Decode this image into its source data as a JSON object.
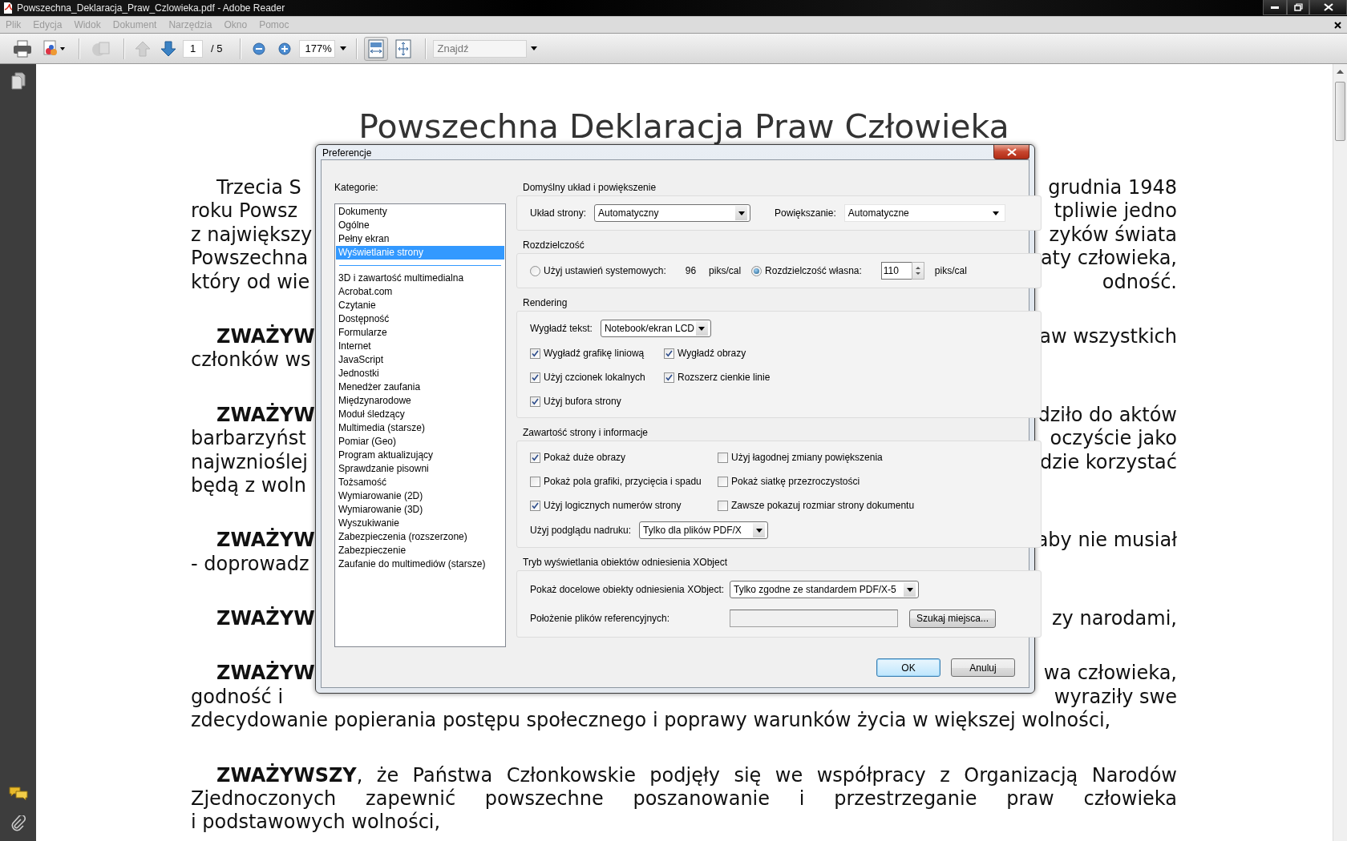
{
  "window": {
    "title": "Powszechna_Deklaracja_Praw_Czlowieka.pdf - Adobe Reader"
  },
  "menu": [
    {
      "label": "Plik",
      "disabled": true
    },
    {
      "label": "Edycja",
      "disabled": true
    },
    {
      "label": "Widok",
      "disabled": true
    },
    {
      "label": "Dokument",
      "disabled": true
    },
    {
      "label": "Narzędzia",
      "disabled": true
    },
    {
      "label": "Okno",
      "disabled": true
    },
    {
      "label": "Pomoc",
      "disabled": true
    }
  ],
  "toolbar": {
    "page_field": "1",
    "page_total": "/ 5",
    "zoom_field": "177%",
    "fit_width": {
      "pressed": true
    },
    "search": {
      "placeholder": "Znajdź"
    }
  },
  "document": {
    "title": "Powszechna Deklaracja Praw Człowieka",
    "paragraphs": [
      {
        "lines": [
          {
            "kind": "split",
            "left": "Trzecia S",
            "right": "grudnia 1948"
          },
          {
            "kind": "split",
            "left": "roku Powsz",
            "right": "tpliwie jedno"
          },
          {
            "kind": "split",
            "left": "z największy",
            "right": "zyków świata"
          },
          {
            "kind": "split",
            "left": "Powszechna",
            "right": "aty człowieka,"
          },
          {
            "kind": "split",
            "left": "który od wie",
            "right": "odność."
          }
        ]
      },
      {
        "lines": [
          {
            "kind": "split",
            "left": "**ZWAŻYW**",
            "right": "aw wszystkich"
          },
          {
            "kind": "split",
            "left": "członków ws"
          }
        ]
      },
      {
        "lines": [
          {
            "kind": "split",
            "left": "**ZWAŻYW**",
            "right": "dziło do aktów"
          },
          {
            "kind": "split",
            "left": "barbarzyńst",
            "right": "oczyście jako"
          },
          {
            "kind": "split",
            "left": "najwznioślej",
            "right": "dzie korzystać"
          },
          {
            "kind": "split",
            "left": "będą z woln"
          }
        ]
      },
      {
        "lines": [
          {
            "kind": "split",
            "left": "**ZWAŻYW**",
            "right": "aby nie musiał"
          },
          {
            "kind": "split",
            "left": "- doprowadz"
          }
        ]
      },
      {
        "lines": [
          {
            "kind": "split",
            "left": "**ZWAŻYW**",
            "right": "zy narodami,"
          }
        ]
      },
      {
        "lines": [
          {
            "kind": "split",
            "left": "**ZWAŻYW**",
            "right": "wa człowieka,"
          },
          {
            "kind": "split",
            "left": "godność i",
            "right": "wyraziły swe"
          },
          {
            "kind": "plain",
            "text": "zdecydowanie popierania postępu społecznego i poprawy warunków życia w większej wolności,"
          }
        ]
      },
      {
        "lines": [
          {
            "kind": "justified",
            "text": "**ZWAŻYWSZY**, że Państwa Członkowskie podjęły się we współpracy z Organizacją Narodów"
          },
          {
            "kind": "justified",
            "text": "Zjednoczonych zapewnić powszechne poszanowanie i przestrzeganie praw człowieka"
          },
          {
            "kind": "plain",
            "text": "i podstawowych wolności,"
          }
        ]
      }
    ]
  },
  "dialog": {
    "title": "Preferencje",
    "categories_label": "Kategorie:",
    "category_groups": [
      {
        "items": [
          {
            "label": "Dokumenty",
            "selected": false
          },
          {
            "label": "Ogólne",
            "selected": false
          },
          {
            "label": "Pełny ekran",
            "selected": false
          },
          {
            "label": "Wyświetlanie strony",
            "selected": true
          }
        ]
      },
      {
        "items": [
          {
            "label": "3D i zawartość multimedialna",
            "selected": false
          },
          {
            "label": "Acrobat.com",
            "selected": false
          },
          {
            "label": "Czytanie",
            "selected": false
          },
          {
            "label": "Dostępność",
            "selected": false
          },
          {
            "label": "Formularze",
            "selected": false
          },
          {
            "label": "Internet",
            "selected": false
          },
          {
            "label": "JavaScript",
            "selected": false
          },
          {
            "label": "Jednostki",
            "selected": false
          },
          {
            "label": "Menedżer zaufania",
            "selected": false
          },
          {
            "label": "Międzynarodowe",
            "selected": false
          },
          {
            "label": "Moduł śledzący",
            "selected": false
          },
          {
            "label": "Multimedia (starsze)",
            "selected": false
          },
          {
            "label": "Pomiar (Geo)",
            "selected": false
          },
          {
            "label": "Program aktualizujący",
            "selected": false
          },
          {
            "label": "Sprawdzanie pisowni",
            "selected": false
          },
          {
            "label": "Tożsamość",
            "selected": false
          },
          {
            "label": "Wymiarowanie (2D)",
            "selected": false
          },
          {
            "label": "Wymiarowanie (3D)",
            "selected": false
          },
          {
            "label": "Wyszukiwanie",
            "selected": false
          },
          {
            "label": "Zabezpieczenia (rozszerzone)",
            "selected": false
          },
          {
            "label": "Zabezpieczenie",
            "selected": false
          },
          {
            "label": "Zaufanie do multimediów (starsze)",
            "selected": false
          }
        ]
      }
    ],
    "sections": [
      {
        "kind": "layout",
        "title": "Domyślny układ i powiększenie",
        "rows": [
          {
            "kind": "line",
            "items": [
              {
                "kind": "label",
                "text": "Układ strony:"
              },
              {
                "kind": "select",
                "value": "Automatyczny"
              },
              {
                "kind": "label",
                "text": "Powiększanie:"
              },
              {
                "kind": "flatselect",
                "value": "Automatyczne"
              }
            ]
          }
        ]
      },
      {
        "kind": "resolution",
        "title": "Rozdzielczość",
        "rows": [
          {
            "kind": "line",
            "items": [
              {
                "kind": "radio",
                "label": "Użyj ustawień systemowych:",
                "selected": false
              },
              {
                "kind": "text",
                "text": "96"
              },
              {
                "kind": "text",
                "text": "piks/cal"
              },
              {
                "kind": "radio",
                "label": "Rozdzielczość własna:",
                "selected": true
              },
              {
                "kind": "spin",
                "value": "110"
              },
              {
                "kind": "text",
                "text": "piks/cal"
              }
            ]
          }
        ]
      },
      {
        "kind": "rendering",
        "title": "Rendering",
        "rows": [
          {
            "kind": "line",
            "items": [
              {
                "kind": "label",
                "text": "Wygładź tekst:"
              },
              {
                "kind": "select",
                "value": "Notebook/ekran LCD"
              }
            ]
          },
          {
            "kind": "checks",
            "items": [
              {
                "kind": "checkbox",
                "label": "Wygładź grafikę liniową",
                "checked": true
              },
              {
                "kind": "checkbox",
                "label": "Wygładź obrazy",
                "checked": true
              }
            ]
          },
          {
            "kind": "checks",
            "items": [
              {
                "kind": "checkbox",
                "label": "Użyj czcionek lokalnych",
                "checked": true
              },
              {
                "kind": "checkbox",
                "label": "Rozszerz cienkie linie",
                "checked": true
              }
            ]
          },
          {
            "kind": "checks",
            "items": [
              {
                "kind": "checkbox",
                "label": "Użyj bufora strony",
                "checked": true
              }
            ]
          }
        ]
      },
      {
        "kind": "content",
        "title": "Zawartość strony i informacje",
        "rows": [
          {
            "kind": "checks",
            "items": [
              {
                "kind": "checkbox",
                "label": "Pokaż duże obrazy",
                "checked": true
              },
              {
                "kind": "checkbox",
                "label": "Użyj łagodnej zmiany powiększenia",
                "checked": false
              }
            ]
          },
          {
            "kind": "checks",
            "items": [
              {
                "kind": "checkbox",
                "label": "Pokaż pola grafiki, przycięcia i spadu",
                "checked": false
              },
              {
                "kind": "checkbox",
                "label": "Pokaż siatkę przezroczystości",
                "checked": false
              }
            ]
          },
          {
            "kind": "checks",
            "items": [
              {
                "kind": "checkbox",
                "label": "Użyj logicznych numerów strony",
                "checked": true
              },
              {
                "kind": "checkbox",
                "label": "Zawsze pokazuj rozmiar strony dokumentu",
                "checked": false
              }
            ]
          },
          {
            "kind": "line",
            "items": [
              {
                "kind": "label",
                "text": "Użyj podglądu nadruku:"
              },
              {
                "kind": "select",
                "value": "Tylko dla plików PDF/X"
              }
            ]
          }
        ]
      },
      {
        "kind": "xobject",
        "title": "Tryb wyświetlania obiektów odniesienia XObject",
        "rows": [
          {
            "kind": "line",
            "items": [
              {
                "kind": "label",
                "text": "Pokaż docelowe obiekty odniesienia XObject:"
              },
              {
                "kind": "select",
                "value": "Tylko zgodne ze standardem PDF/X-5"
              }
            ]
          },
          {
            "kind": "line",
            "items": [
              {
                "kind": "label",
                "text": "Położenie plików referencyjnych:"
              },
              {
                "kind": "field"
              },
              {
                "kind": "button",
                "text": "Szukaj miejsca..."
              }
            ]
          }
        ]
      }
    ],
    "buttons": [
      {
        "label": "OK",
        "default": true
      },
      {
        "label": "Anuluj",
        "default": false
      }
    ]
  }
}
